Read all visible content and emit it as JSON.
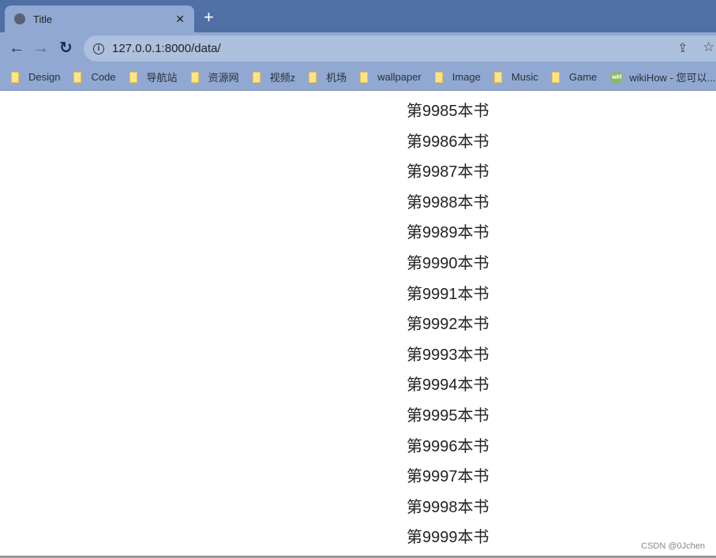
{
  "tab": {
    "title": "Title",
    "icon": "globe-icon",
    "close": "✕",
    "new_tab": "+"
  },
  "toolbar": {
    "back": "←",
    "forward": "→",
    "reload": "↻",
    "url": "127.0.0.1:8000/data/"
  },
  "bookmarks": [
    {
      "label": "Design",
      "icon": "folder-icon"
    },
    {
      "label": "Code",
      "icon": "folder-icon"
    },
    {
      "label": "导航站",
      "icon": "folder-icon"
    },
    {
      "label": "资源网",
      "icon": "folder-icon"
    },
    {
      "label": "视频z",
      "icon": "folder-icon"
    },
    {
      "label": "机场",
      "icon": "folder-icon"
    },
    {
      "label": "wallpaper",
      "icon": "folder-icon"
    },
    {
      "label": "Image",
      "icon": "folder-icon"
    },
    {
      "label": "Music",
      "icon": "folder-icon"
    },
    {
      "label": "Game",
      "icon": "folder-icon"
    },
    {
      "label": "wikiHow - 您可以...",
      "icon": "wikihow-icon"
    }
  ],
  "items": [
    "第9985本书",
    "第9986本书",
    "第9987本书",
    "第9988本书",
    "第9989本书",
    "第9990本书",
    "第9991本书",
    "第9992本书",
    "第9993本书",
    "第9994本书",
    "第9995本书",
    "第9996本书",
    "第9997本书",
    "第9998本书",
    "第9999本书"
  ],
  "watermark": "CSDN @0Jchen"
}
